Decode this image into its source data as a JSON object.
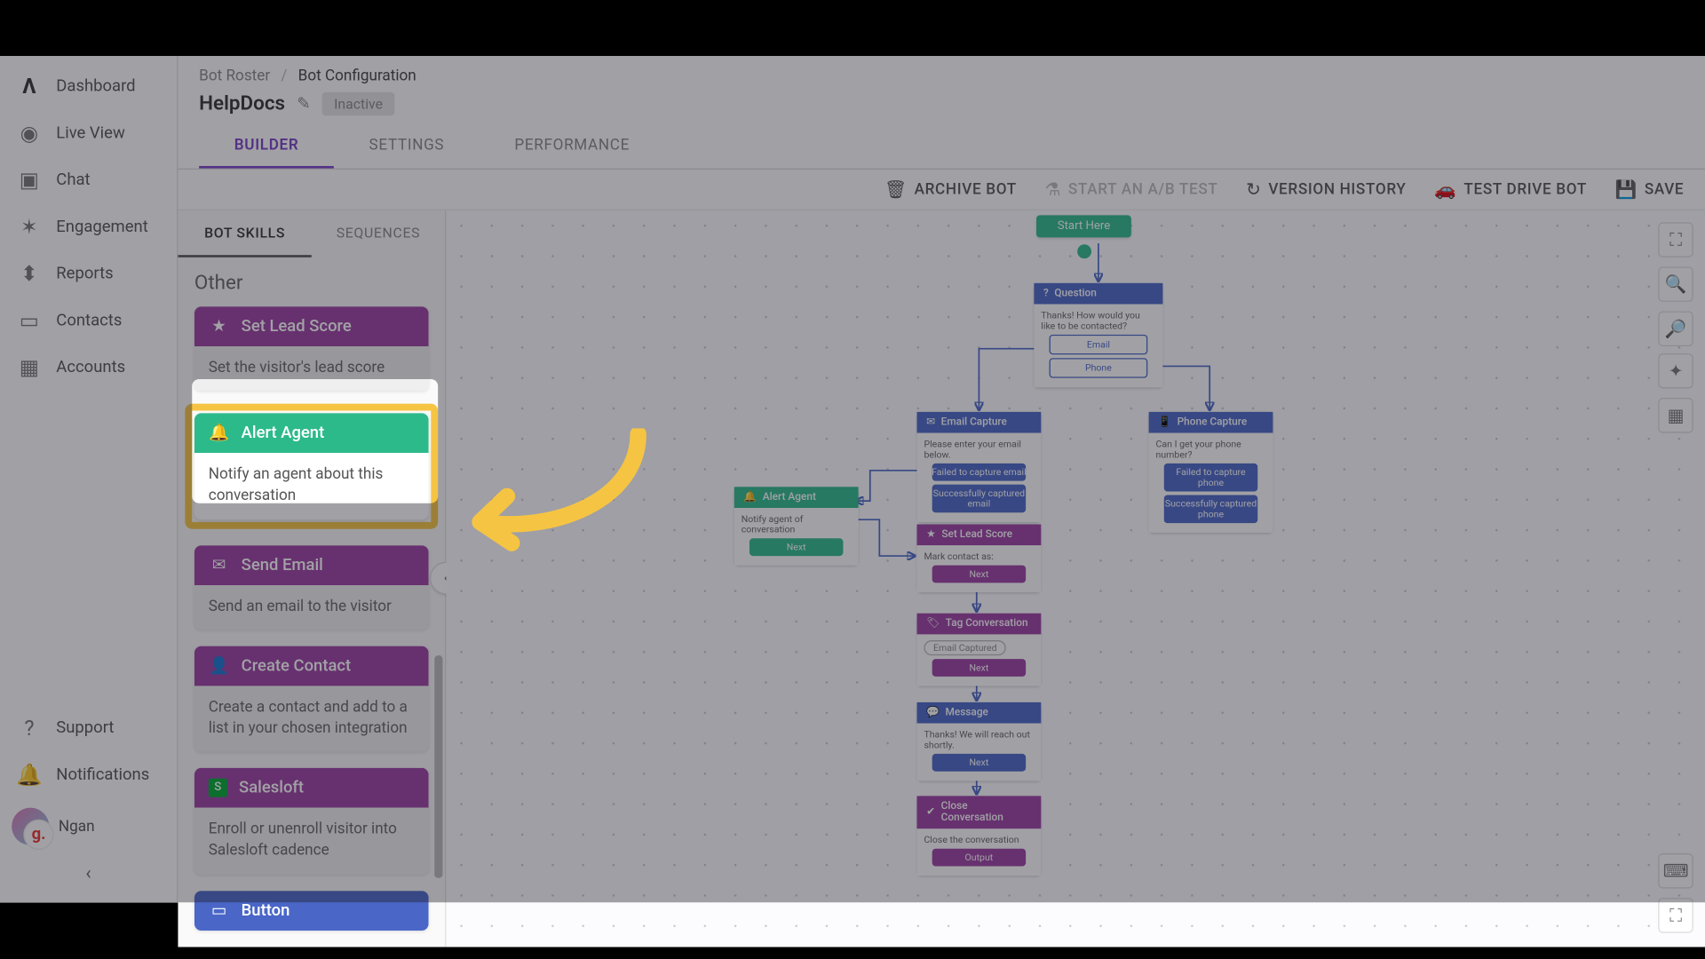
{
  "sidebar": {
    "items": [
      {
        "label": "Dashboard",
        "icon": "Λ"
      },
      {
        "label": "Live View",
        "icon": "◉"
      },
      {
        "label": "Chat",
        "icon": "▣"
      },
      {
        "label": "Engagement",
        "icon": "✶"
      },
      {
        "label": "Reports",
        "icon": "▮"
      },
      {
        "label": "Contacts",
        "icon": "▭"
      },
      {
        "label": "Accounts",
        "icon": "▦"
      }
    ],
    "bottom": [
      {
        "label": "Support",
        "icon": "?"
      },
      {
        "label": "Notifications",
        "icon": "🔔"
      }
    ],
    "user": "Ngan",
    "avatar_letter": "g."
  },
  "breadcrumb": {
    "root": "Bot Roster",
    "current": "Bot Configuration"
  },
  "bot": {
    "name": "HelpDocs",
    "status": "Inactive"
  },
  "tabs": {
    "builder": "BUILDER",
    "settings": "SETTINGS",
    "performance": "PERFORMANCE"
  },
  "actions": {
    "archive": "ARCHIVE BOT",
    "abtest": "START AN A/B TEST",
    "history": "VERSION HISTORY",
    "testdrive": "TEST DRIVE BOT",
    "save": "SAVE"
  },
  "panel_tabs": {
    "skills": "BOT SKILLS",
    "sequences": "SEQUENCES"
  },
  "section": "Other",
  "skills": {
    "lead_score": {
      "title": "Set Lead Score",
      "desc": "Set the visitor's lead score",
      "color": "purple"
    },
    "alert_agent": {
      "title": "Alert Agent",
      "desc": "Notify an agent about this conversation",
      "color": "green"
    },
    "send_email": {
      "title": "Send Email",
      "desc": "Send an email to the visitor",
      "color": "purple"
    },
    "create_contact": {
      "title": "Create Contact",
      "desc": "Create a contact and add to a list in your chosen integration",
      "color": "purple"
    },
    "salesloft": {
      "title": "Salesloft",
      "desc": "Enroll or unenroll visitor into Salesloft cadence",
      "color": "purple"
    },
    "button": {
      "title": "Button",
      "desc": "",
      "color": "blue"
    }
  },
  "flow": {
    "start": "Start Here",
    "question": {
      "title": "Question",
      "text": "Thanks! How would you like to be contacted?",
      "opt1": "Email",
      "opt2": "Phone"
    },
    "email_capture": {
      "title": "Email Capture",
      "text": "Please enter your email below.",
      "fail": "Failed to capture email",
      "ok": "Successfully captured email"
    },
    "phone_capture": {
      "title": "Phone Capture",
      "text": "Can I get your phone number?",
      "fail": "Failed to capture phone",
      "ok": "Successfully captured phone"
    },
    "alert_agent": {
      "title": "Alert Agent",
      "text": "Notify agent of conversation",
      "next": "Next"
    },
    "lead_score": {
      "title": "Set Lead Score",
      "text": "Mark contact as:",
      "next": "Next"
    },
    "tag": {
      "title": "Tag Conversation",
      "chip": "Email Captured",
      "next": "Next"
    },
    "message": {
      "title": "Message",
      "text": "Thanks! We will reach out shortly.",
      "next": "Next"
    },
    "close": {
      "title": "Close Conversation",
      "text": "Close the conversation",
      "out": "Output"
    }
  }
}
